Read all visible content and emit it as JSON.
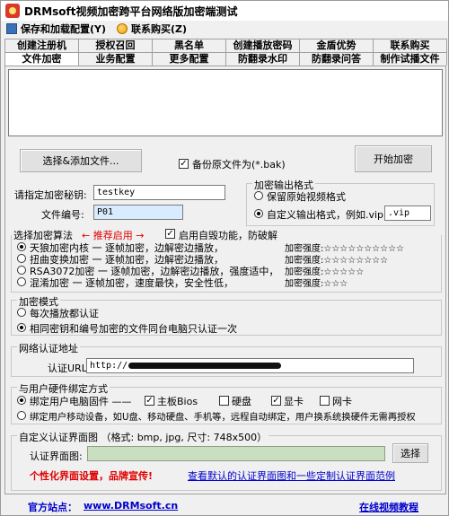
{
  "window": {
    "title": "DRMsoft视频加密跨平台网络版加密端测试"
  },
  "menu": {
    "save_config": "保存和加载配置(Y)",
    "contact": "联系购买(Z)"
  },
  "tabs_top": [
    "创建注册机",
    "授权召回",
    "黑名单",
    "创建播放密码",
    "金盾优势",
    "联系购买"
  ],
  "tabs_bottom": [
    "文件加密",
    "业务配置",
    "更多配置",
    "防翻录水印",
    "防翻录问答",
    "制作试播文件"
  ],
  "file_section": {
    "select_button": "选择&添加文件...",
    "backup_label": "备份原文件为(*.bak)",
    "start_button": "开始加密"
  },
  "key": {
    "label": "请指定加密秘钥:",
    "value": "testkey"
  },
  "file_no": {
    "label": "文件编号:",
    "value": "P01"
  },
  "output": {
    "title": "加密输出格式",
    "keep_original": "保留原始视频格式",
    "custom_format": "自定义输出格式，例如.vip",
    "custom_value": ".vip"
  },
  "algo": {
    "title": "选择加密算法",
    "recommend": "← 推荐启用 →",
    "self_destroy": "启用自毁功能，防破解",
    "options": [
      {
        "name": "天狼加密内核 一 逐帧加密，边解密边播放，",
        "strength": "加密强度:☆☆☆☆☆☆☆☆☆☆"
      },
      {
        "name": "扭曲变换加密 一 逐帧加密，边解密边播放，",
        "strength": "加密强度:☆☆☆☆☆☆☆☆"
      },
      {
        "name": "RSA3072加密 一 逐帧加密，边解密边播放，强度适中，",
        "strength": "加密强度:☆☆☆☆☆"
      },
      {
        "name": "混淆加密 一 逐帧加密，速度最快，安全性低，",
        "strength": "加密强度:☆☆☆"
      }
    ]
  },
  "encrypt_mode": {
    "title": "加密模式",
    "every_play": "每次播放都认证",
    "same_pc": "相同密钥和编号加密的文件同台电脑只认证一次"
  },
  "network": {
    "title": "网络认证地址",
    "url_label": "认证URL:",
    "url_value": "http://"
  },
  "hw_bind": {
    "title": "与用户硬件绑定方式",
    "bind_pc": "绑定用户电脑固件 ——",
    "board": "主板Bios",
    "disk": "硬盘",
    "gpu": "显卡",
    "nic": "网卡",
    "bind_mobile": "绑定用户移动设备，如U盘、移动硬盘、手机等，远程自动绑定，用户换系统换硬件无需再授权"
  },
  "custom_ui": {
    "title": "自定义认证界面图 （格式: bmp, jpg, 尺寸: 748x500）",
    "image_label": "认证界面图:",
    "select_button": "选择",
    "promo": "个性化界面设置，品牌宣传!",
    "sample_link": "查看默认的认证界面图和一些定制认证界面范例"
  },
  "footer": {
    "site_label": "官方站点：",
    "site_url": "www.DRMsoft.cn",
    "video_link": "在线视频教程"
  }
}
